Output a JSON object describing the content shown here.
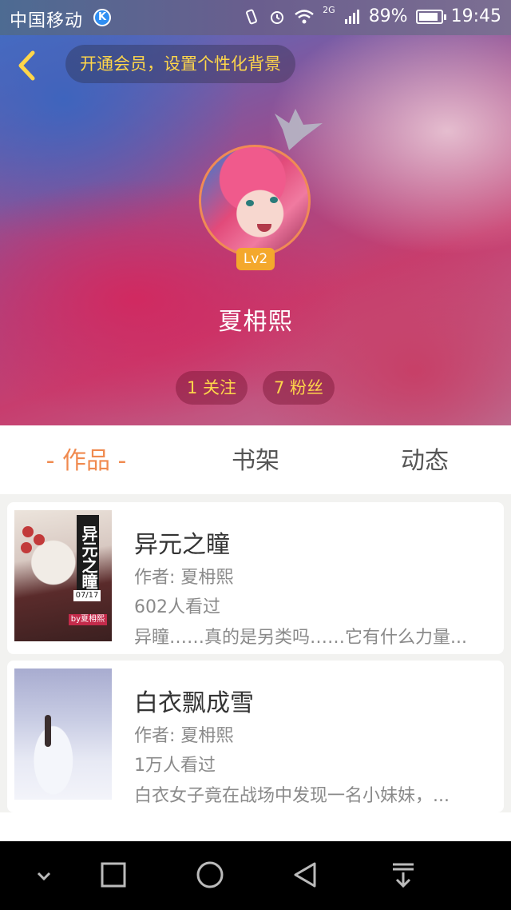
{
  "status_bar": {
    "carrier": "中国移动",
    "carrier_badge": "K",
    "network": "2G",
    "battery": "89%",
    "battery_level": 0.89,
    "time": "19:45"
  },
  "header": {
    "vip_text": "开通会员，设置个性化背景",
    "level": "Lv2",
    "username": "夏枏熙",
    "following": "1 关注",
    "fans": "7 粉丝",
    "accent_color": "#ffd64a"
  },
  "tabs": [
    {
      "label": "- 作品 -",
      "active": true
    },
    {
      "label": "书架",
      "active": false
    },
    {
      "label": "动态",
      "active": false
    }
  ],
  "books": [
    {
      "title": "异元之瞳",
      "author": "作者: 夏枏熙",
      "views": "602人看过",
      "description": "异瞳……真的是另类吗……它有什么力量...",
      "cover_title": "异元之瞳",
      "cover_date": "07/17",
      "cover_byline": "by夏枏熙"
    },
    {
      "title": "白衣飘成雪",
      "author": "作者: 夏枏熙",
      "views": "1万人看过",
      "description": "白衣女子竟在战场中发现一名小妹妹，..."
    }
  ],
  "nav_bar": {
    "icons": [
      "chevron-down-icon",
      "recent-apps-icon",
      "home-icon",
      "back-triangle-icon",
      "download-icon"
    ]
  }
}
